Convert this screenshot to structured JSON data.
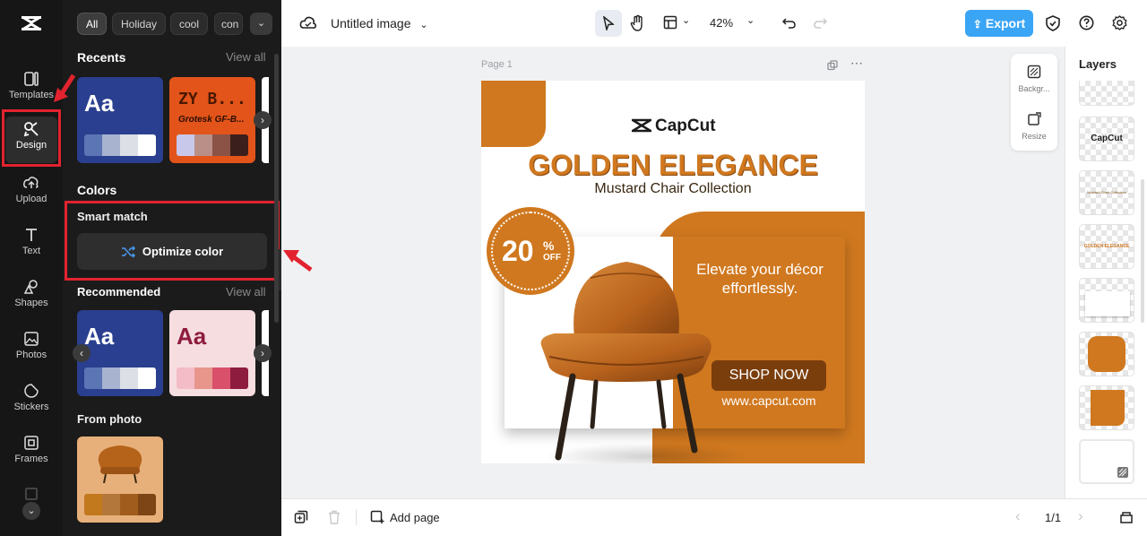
{
  "rail": {
    "items": [
      {
        "label": "Templates",
        "icon": "templates-icon"
      },
      {
        "label": "Design",
        "icon": "design-icon"
      },
      {
        "label": "Upload",
        "icon": "upload-icon"
      },
      {
        "label": "Text",
        "icon": "text-icon"
      },
      {
        "label": "Shapes",
        "icon": "shapes-icon"
      },
      {
        "label": "Photos",
        "icon": "photos-icon"
      },
      {
        "label": "Stickers",
        "icon": "stickers-icon"
      },
      {
        "label": "Frames",
        "icon": "frames-icon"
      }
    ],
    "active": "Design"
  },
  "filters": [
    "All",
    "Holiday",
    "cool",
    "con"
  ],
  "recents": {
    "title": "Recents",
    "view_all": "View all",
    "card1": {
      "text": "Aa",
      "bg": "#2a3f8f",
      "swatches": [
        "#5c75b4",
        "#a7b3cf",
        "#dcdfe6",
        "#ffffff"
      ]
    },
    "card2": {
      "text": "ZY B...",
      "caption": "Grotesk GF-B...",
      "bg": "#e2541a",
      "swatches": [
        "#c8c9ea",
        "#b98f88",
        "#8a5346",
        "#3b1f1c"
      ]
    }
  },
  "colors": {
    "title": "Colors",
    "smart_match": "Smart match",
    "optimize": "Optimize color"
  },
  "recommended": {
    "title": "Recommended",
    "view_all": "View all",
    "card1": {
      "text": "Aa",
      "bg": "#2a3f8f",
      "swatches": [
        "#5c75b4",
        "#a7b3cf",
        "#dcdfe6",
        "#ffffff"
      ]
    },
    "card2": {
      "text": "Aa",
      "bg": "#f6dde0",
      "swatches": [
        "#f3bcc6",
        "#e8958c",
        "#d9506b",
        "#8e1c3e"
      ]
    }
  },
  "from_photo": {
    "title": "From photo",
    "swatches": [
      "#c2781d",
      "#b3773c",
      "#a05c1c",
      "#7d4516"
    ]
  },
  "topbar": {
    "doc_title": "Untitled image",
    "zoom": "42%",
    "export": "Export"
  },
  "canvas": {
    "page_label": "Page 1"
  },
  "design": {
    "logo": "CapCut",
    "title": "GOLDEN ELEGANCE",
    "subtitle": "Mustard Chair Collection",
    "badge_value": "20",
    "badge_pct": "%",
    "badge_off": "OFF",
    "tagline": "Elevate your décor effortlessly.",
    "cta": "SHOP NOW",
    "url": "www.capcut.com",
    "accent": "#d0781f"
  },
  "floatbox": {
    "background": "Backgr...",
    "resize": "Resize"
  },
  "layers": {
    "title": "Layers",
    "thumb_capcut": "CapCut",
    "thumb_subtitle": "Mustard Chair Collection",
    "thumb_title": "GOLDEN ELEGANCE"
  },
  "bottombar": {
    "add_page": "Add page",
    "page_count": "1/1"
  }
}
